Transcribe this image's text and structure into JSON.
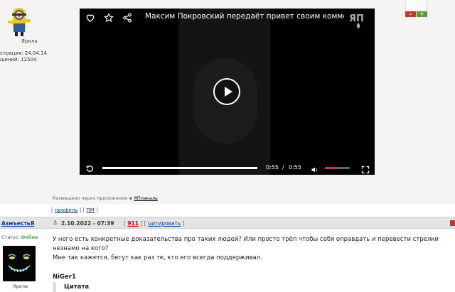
{
  "top_post": {
    "user": "Ярила",
    "registration": "страция: 24.04.14",
    "messages": "щений: 12504"
  },
  "vote": {
    "minus": "–",
    "plus": "+"
  },
  "player": {
    "title": "Максим Покровский передаёт привет своим комментат…",
    "logo": "ЯП",
    "current_time": "0:55",
    "separator": "/",
    "duration": "0:55",
    "progress": 1.0,
    "volume": 0.45,
    "icons": [
      "heart-icon",
      "star-icon",
      "share-icon",
      "play-icon",
      "replay-icon",
      "volume-icon",
      "fullscreen-icon"
    ]
  },
  "posted_via": {
    "text": "Размещено через приложение",
    "app": "ЯПлакаль"
  },
  "profile_links": {
    "open1": "[ ",
    "profile": "профиль",
    "mid": " ] [ ",
    "pm": "ПМ",
    "close": " ]"
  },
  "post": {
    "username": "АзмъестьЯ",
    "date": "2.10.2022 - 07:39",
    "tools_open": "[ ",
    "number": "911",
    "tools_mid": " ] [ ",
    "quote": "цитировать",
    "tools_close": " ]",
    "status_label": "Статус: ",
    "status_value": "Online",
    "author_name": "Ярила",
    "body_line1": "У него есть конкретные доказательства про таких людей? Или просто трёп чтобы себя оправдать и перевести стрелки",
    "body_line2": "незнамо на кого?",
    "body_line3": "Мне так кажется, бегут как раз те, кто его всегда поддерживал.",
    "quote_author": "NiGer1",
    "quote_head": "Цитата"
  },
  "colors": {
    "accent_red": "#cc0000",
    "link_blue": "#0044aa",
    "online_green": "#3aaa35",
    "player_bg": "#000000",
    "volume_red": "#d9343a"
  }
}
